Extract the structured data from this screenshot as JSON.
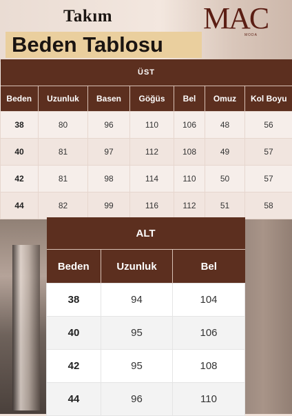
{
  "header": {
    "title_small": "Takım",
    "title_big": "Beden Tablosu",
    "logo": "MAC",
    "logo_sub": "MODA"
  },
  "ust_table": {
    "section": "ÜST",
    "headers": [
      "Beden",
      "Uzunluk",
      "Basen",
      "Göğüs",
      "Bel",
      "Omuz",
      "Kol Boyu"
    ],
    "rows": [
      [
        "38",
        "80",
        "96",
        "110",
        "106",
        "48",
        "56"
      ],
      [
        "40",
        "81",
        "97",
        "112",
        "108",
        "49",
        "57"
      ],
      [
        "42",
        "81",
        "98",
        "114",
        "110",
        "50",
        "57"
      ],
      [
        "44",
        "82",
        "99",
        "116",
        "112",
        "51",
        "58"
      ]
    ]
  },
  "alt_table": {
    "section": "ALT",
    "headers": [
      "Beden",
      "Uzunluk",
      "Bel"
    ],
    "rows": [
      [
        "38",
        "94",
        "104"
      ],
      [
        "40",
        "95",
        "106"
      ],
      [
        "42",
        "95",
        "108"
      ],
      [
        "44",
        "96",
        "110"
      ]
    ]
  },
  "colors": {
    "header_brown": "#5c2f1f",
    "title_highlight": "#eacf9e",
    "logo_color": "#5b1e14"
  }
}
